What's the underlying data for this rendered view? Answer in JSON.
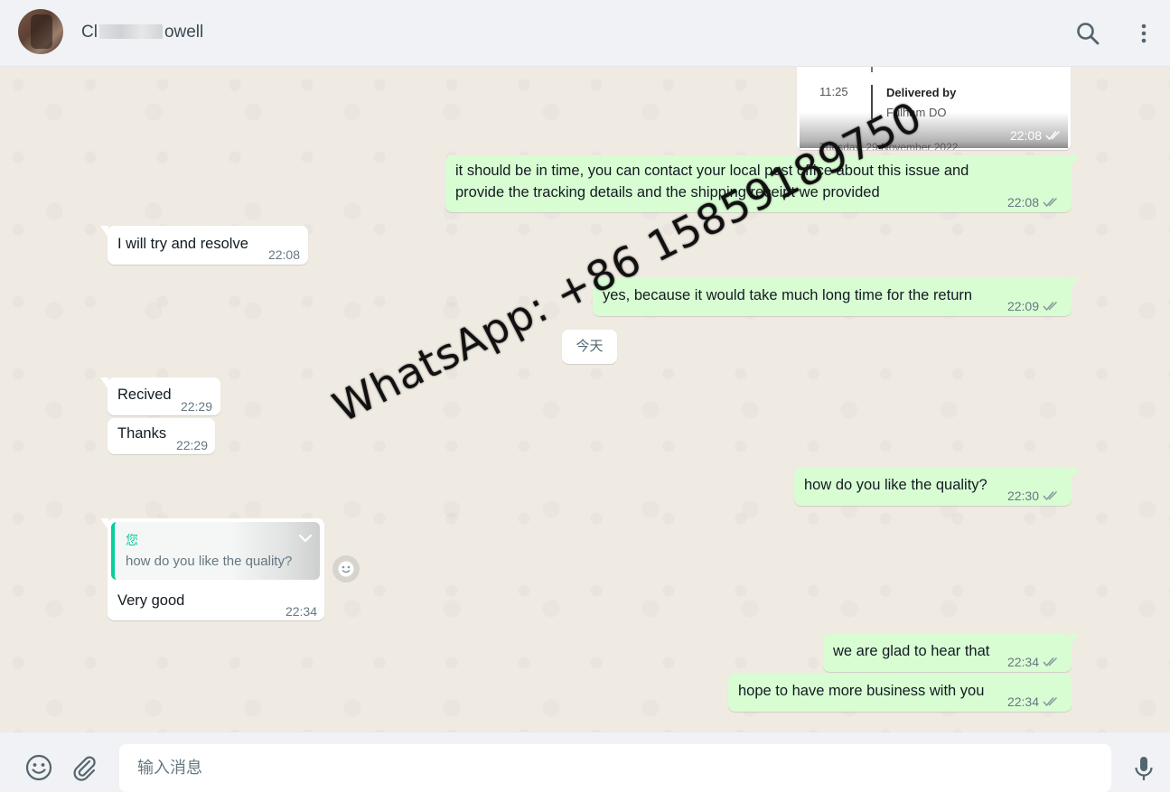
{
  "header": {
    "contact_name_start": "Cl",
    "contact_name_end": "owell",
    "search_icon": "search-icon",
    "menu_icon": "kebab-menu-icon"
  },
  "tracking_card": {
    "time": "11:25",
    "title": "Delivered by",
    "subtitle": "Fulham DO",
    "footer_text": "Tuesday, 29 November 2022",
    "timestamp": "22:08"
  },
  "messages": [
    {
      "direction": "out",
      "text_line1": "it should be in time, you can contact your local post office about this issue and",
      "text_line2": "provide the tracking details and the shipping receipt we provided",
      "time": "22:08"
    },
    {
      "direction": "in",
      "text": "I will try and resolve",
      "time": "22:08"
    },
    {
      "direction": "out",
      "text": "yes, because it would take much long time for the return",
      "time": "22:09"
    },
    {
      "direction": "in",
      "text": "Recived",
      "time": "22:29"
    },
    {
      "direction": "in",
      "text": "Thanks",
      "time": "22:29"
    },
    {
      "direction": "out",
      "text": "how do you like the quality?",
      "time": "22:30"
    },
    {
      "direction": "in",
      "text": "Very good",
      "time": "22:34",
      "quote_author": "您",
      "quote_text": "how do you like the quality?"
    },
    {
      "direction": "out",
      "text": "we are glad to hear that",
      "time": "22:34"
    },
    {
      "direction": "out",
      "text": "hope to have more business with you",
      "time": "22:34"
    }
  ],
  "date_divider": "今天",
  "watermark": "WhatsApp: +86 15859189750",
  "composer": {
    "placeholder": "输入消息",
    "emoji_icon": "emoji-icon",
    "attach_icon": "paperclip-icon",
    "mic_icon": "microphone-icon"
  },
  "colors": {
    "outgoing_bubble": "#d9fdd3",
    "incoming_bubble": "#ffffff",
    "chat_background": "#efeae2",
    "accent": "#06cf9c",
    "read_ticks": "#8696a0"
  }
}
